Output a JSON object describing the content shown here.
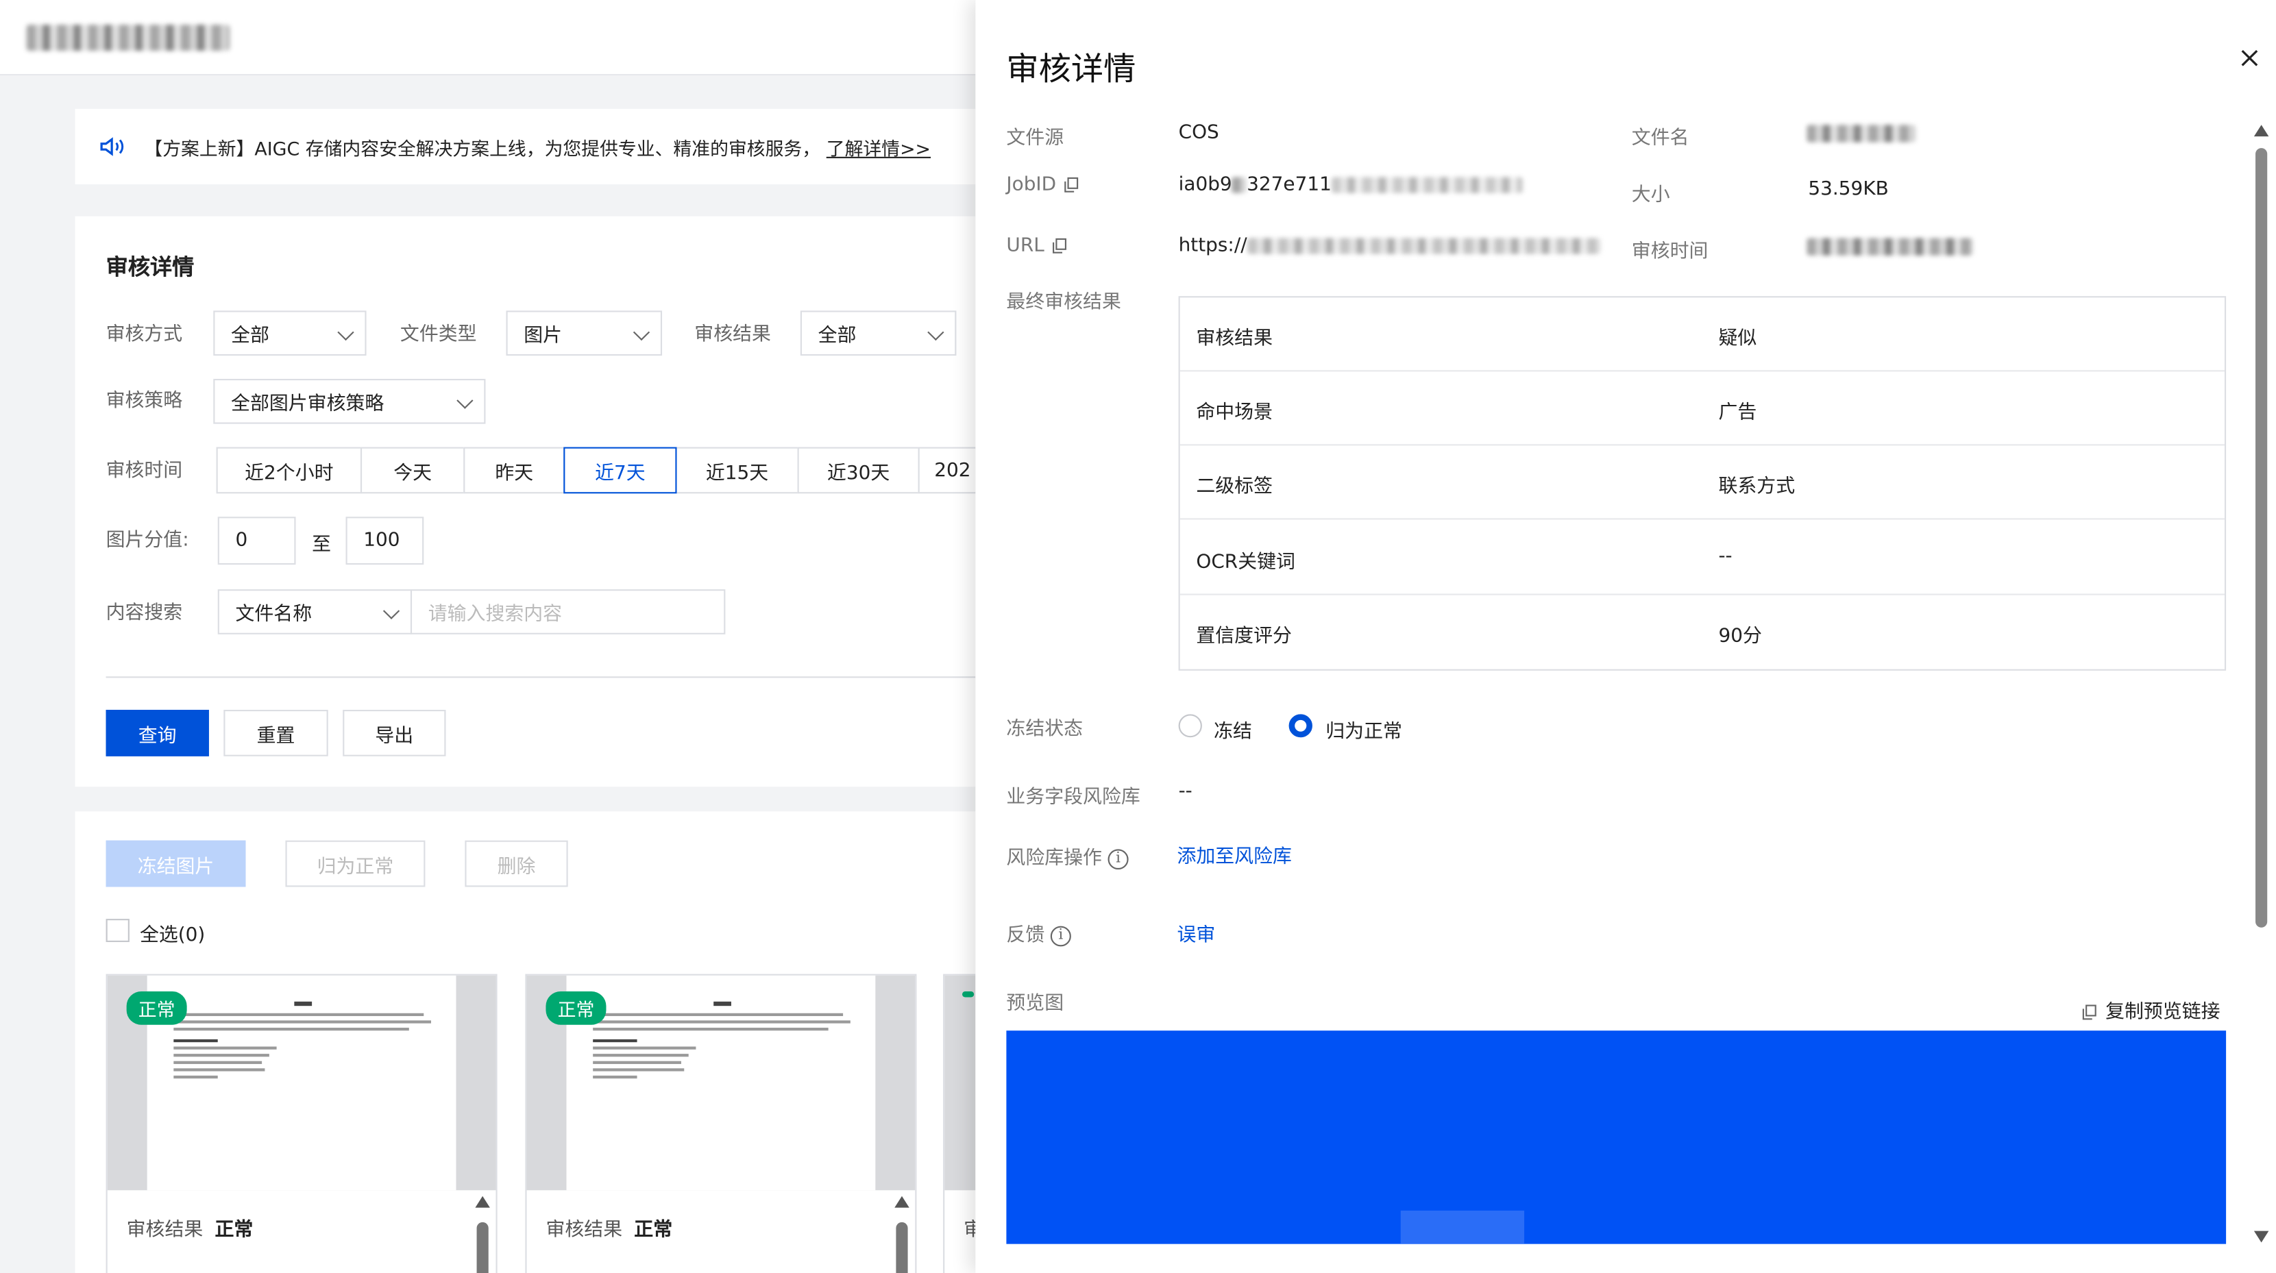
{
  "topbar": {
    "title_blurred": ""
  },
  "notice": {
    "text": "【方案上新】AIGC 存储内容安全解决方案上线，为您提供专业、精准的审核服务，",
    "link": "了解详情>>"
  },
  "filters": {
    "title": "审核详情",
    "review_method_label": "审核方式",
    "review_method_value": "全部",
    "file_type_label": "文件类型",
    "file_type_value": "图片",
    "review_result_label": "审核结果",
    "review_result_value": "全部",
    "strategy_label": "审核策略",
    "strategy_value": "全部图片审核策略",
    "time_label": "审核时间",
    "time_options": [
      "近2个小时",
      "今天",
      "昨天",
      "近7天",
      "近15天",
      "近30天",
      "202"
    ],
    "time_active": "近7天",
    "score_label": "图片分值:",
    "score_min": "0",
    "score_to": "至",
    "score_max": "100",
    "search_label": "内容搜索",
    "search_field": "文件名称",
    "search_placeholder": "请输入搜索内容",
    "query_btn": "查询",
    "reset_btn": "重置",
    "export_btn": "导出"
  },
  "results": {
    "freeze_btn": "冻结图片",
    "normal_btn": "归为正常",
    "delete_btn": "删除",
    "select_all": "全选(0)",
    "cards": [
      {
        "tag": "正常",
        "result_label": "审核结果",
        "result_value": "正常"
      },
      {
        "tag": "正常",
        "result_label": "审核结果",
        "result_value": "正常"
      },
      {
        "tag": "",
        "result_label": "审",
        "result_value": ""
      }
    ]
  },
  "drawer": {
    "title": "审核详情",
    "file_source_label": "文件源",
    "file_source_value": "COS",
    "file_name_label": "文件名",
    "jobid_label": "JobID",
    "jobid_value": "ia0b9",
    "jobid_value_mid": "327e711",
    "size_label": "大小",
    "size_value": "53.59KB",
    "url_label": "URL",
    "url_value": "https://",
    "review_time_label": "审核时间",
    "final_result_label": "最终审核结果",
    "result_rows": [
      {
        "k": "审核结果",
        "v": "疑似"
      },
      {
        "k": "命中场景",
        "v": "广告"
      },
      {
        "k": "二级标签",
        "v": "联系方式"
      },
      {
        "k": "OCR关键词",
        "v": "--"
      },
      {
        "k": "置信度评分",
        "v": "90分"
      }
    ],
    "freeze_status_label": "冻结状态",
    "freeze_option": "冻结",
    "normal_option": "归为正常",
    "risk_lib_label": "业务字段风险库",
    "risk_lib_value": "--",
    "risk_op_label": "风险库操作",
    "risk_op_link": "添加至风险库",
    "feedback_label": "反馈",
    "feedback_link": "误审",
    "preview_label": "预览图",
    "copy_preview_link": "复制预览链接",
    "preview_color": "#0052f5"
  },
  "colors": {
    "primary": "#0052d9",
    "success": "#00a870"
  }
}
